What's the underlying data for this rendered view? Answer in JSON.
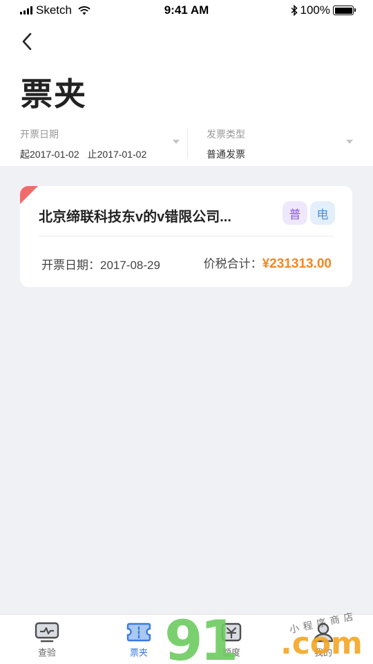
{
  "status_bar": {
    "carrier": "Sketch",
    "time": "9:41 AM",
    "battery": "100%"
  },
  "header": {
    "title": "票夹"
  },
  "filters": {
    "date": {
      "label": "开票日期",
      "start": "起2017-01-02",
      "end": "止2017-01-02"
    },
    "type": {
      "label": "发票类型",
      "value": "普通发票"
    }
  },
  "invoices": [
    {
      "company": "北京缔联科技东v的v错限公司...",
      "tags": [
        "普",
        "电"
      ],
      "date_label": "开票日期：",
      "date": "2017-08-29",
      "total_label": "价税合计：",
      "total": "¥231313.00"
    }
  ],
  "tab_bar": {
    "tabs": [
      {
        "label": "查验",
        "icon": "inspect-icon",
        "active": false
      },
      {
        "label": "票夹",
        "icon": "ticket-icon",
        "active": true
      },
      {
        "label": "额度",
        "icon": "quota-icon",
        "active": false
      },
      {
        "label": "我的",
        "icon": "profile-icon",
        "active": false
      }
    ]
  },
  "watermark": {
    "digits": "91",
    "suffix": ".com",
    "text": "小程序商店"
  },
  "colors": {
    "accent": "#3a7be0",
    "amount": "#f5851f",
    "corner": "#f26b6b",
    "background": "#f0f1f5"
  }
}
